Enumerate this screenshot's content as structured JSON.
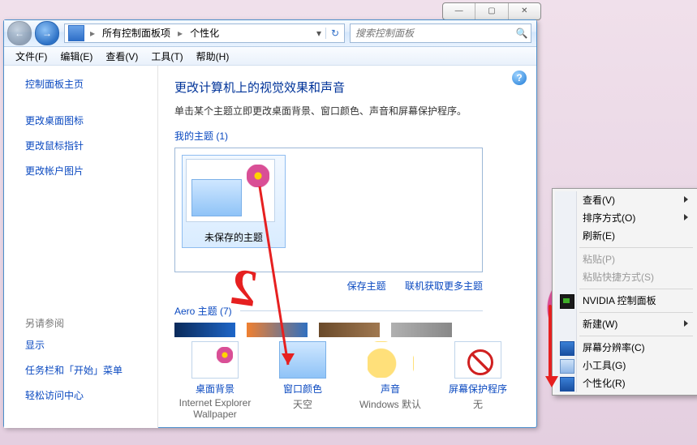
{
  "wincaps": {
    "min": "—",
    "max": "▢",
    "close": "✕"
  },
  "toolbar": {
    "nav_back": "←",
    "nav_fwd": "→",
    "addr": {
      "seg1": "所有控制面板项",
      "seg2": "个性化",
      "drop": "▾",
      "refresh": "↻"
    },
    "search": {
      "placeholder": "搜索控制面板",
      "icon": "🔍"
    }
  },
  "menu": {
    "file": "文件(F)",
    "edit": "编辑(E)",
    "view": "查看(V)",
    "tools": "工具(T)",
    "help": "帮助(H)"
  },
  "side": {
    "home": "控制面板主页",
    "icons": "更改桌面图标",
    "pointer": "更改鼠标指针",
    "pic": "更改帐户图片",
    "seealso": "另请参阅",
    "display": "显示",
    "taskbar": "任务栏和「开始」菜单",
    "ease": "轻松访问中心"
  },
  "main": {
    "title": "更改计算机上的视觉效果和声音",
    "sub": "单击某个主题立即更改桌面背景、窗口颜色、声音和屏幕保护程序。",
    "mythemes": "我的主题 (1)",
    "unsaved": "未保存的主题",
    "save": "保存主题",
    "online": "联机获取更多主题",
    "aero": "Aero 主题 (7)",
    "help": "?"
  },
  "quick": {
    "bg": {
      "label": "桌面背景",
      "sub": "Internet Explorer Wallpaper"
    },
    "color": {
      "label": "窗口颜色",
      "sub": "天空"
    },
    "sound": {
      "label": "声音",
      "sub": "Windows 默认"
    },
    "saver": {
      "label": "屏幕保护程序",
      "sub": "无"
    }
  },
  "ctx": {
    "view": "查看(V)",
    "sort": "排序方式(O)",
    "refresh": "刷新(E)",
    "paste": "粘贴(P)",
    "pastesc": "粘贴快捷方式(S)",
    "nvidia": "NVIDIA 控制面板",
    "new": "新建(W)",
    "res": "屏幕分辨率(C)",
    "gadget": "小工具(G)",
    "personalize": "个性化(R)"
  }
}
